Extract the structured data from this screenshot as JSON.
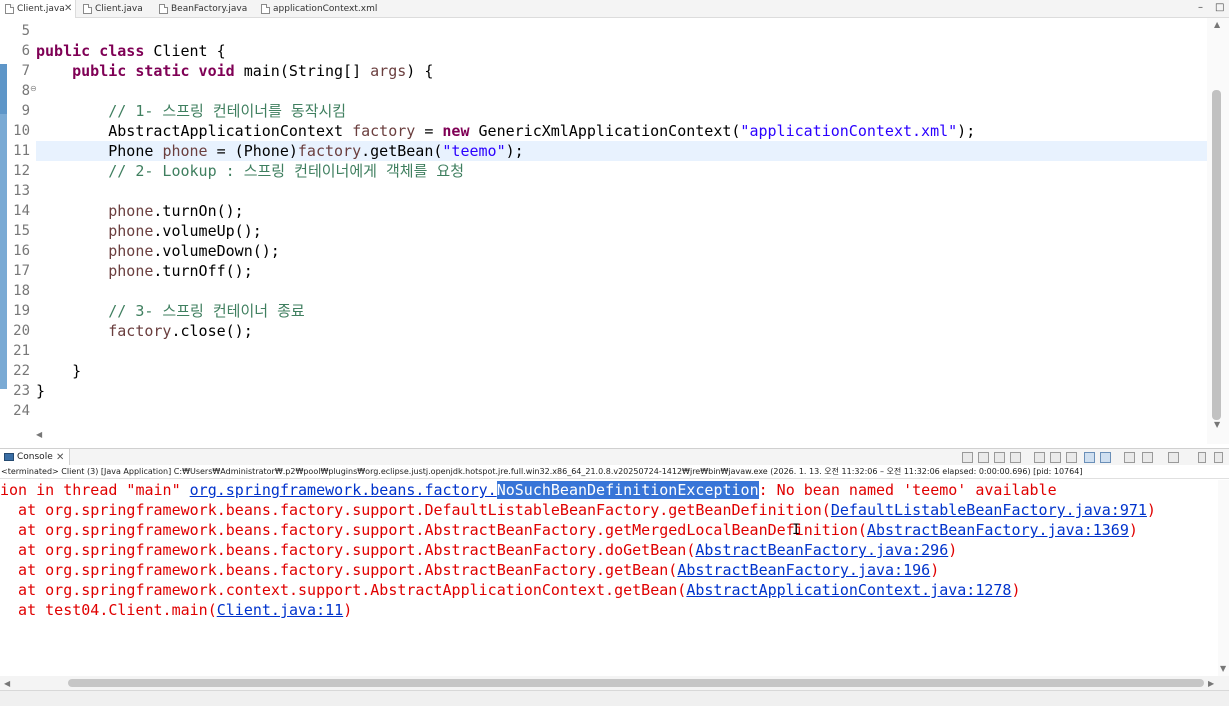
{
  "editor_tabs": [
    {
      "label": "Client.java",
      "active": true,
      "close": "✕"
    },
    {
      "label": "Client.java",
      "active": false
    },
    {
      "label": "BeanFactory.java",
      "active": false
    },
    {
      "label": "applicationContext.xml",
      "active": false
    }
  ],
  "window_controls": {
    "minimize": "–",
    "maximize": "□"
  },
  "code": {
    "lines": [
      {
        "n": "5",
        "current": false,
        "segs": []
      },
      {
        "n": "6",
        "current": false,
        "segs": [
          {
            "t": "public class",
            "c": "kw"
          },
          {
            "t": " Client {",
            "c": ""
          }
        ]
      },
      {
        "n": "7",
        "current": false,
        "fold": "⊖",
        "segs": [
          {
            "t": "    ",
            "c": ""
          },
          {
            "t": "public static void",
            "c": "kw"
          },
          {
            "t": " main(String[] ",
            "c": ""
          },
          {
            "t": "args",
            "c": "var"
          },
          {
            "t": ") {",
            "c": ""
          }
        ]
      },
      {
        "n": "8",
        "current": false,
        "segs": []
      },
      {
        "n": "9",
        "current": false,
        "segs": [
          {
            "t": "        ",
            "c": ""
          },
          {
            "t": "// 1- 스프링 컨테이너를 동작시킴",
            "c": "cmt"
          }
        ]
      },
      {
        "n": "10",
        "current": false,
        "segs": [
          {
            "t": "        AbstractApplicationContext ",
            "c": ""
          },
          {
            "t": "factory",
            "c": "var"
          },
          {
            "t": " = ",
            "c": ""
          },
          {
            "t": "new",
            "c": "kw"
          },
          {
            "t": " GenericXmlApplicationContext(",
            "c": ""
          },
          {
            "t": "\"applicationContext.xml\"",
            "c": "str"
          },
          {
            "t": ");",
            "c": ""
          }
        ]
      },
      {
        "n": "11",
        "current": true,
        "segs": [
          {
            "t": "        Phone ",
            "c": ""
          },
          {
            "t": "phone",
            "c": "var"
          },
          {
            "t": " = (Phone)",
            "c": ""
          },
          {
            "t": "factory",
            "c": "var"
          },
          {
            "t": ".getBean(",
            "c": ""
          },
          {
            "t": "\"teemo\"",
            "c": "str"
          },
          {
            "t": ");",
            "c": ""
          }
        ]
      },
      {
        "n": "12",
        "current": false,
        "segs": [
          {
            "t": "        ",
            "c": ""
          },
          {
            "t": "// 2- Lookup : 스프링 컨테이너에게 객체를 요청",
            "c": "cmt"
          }
        ]
      },
      {
        "n": "13",
        "current": false,
        "segs": []
      },
      {
        "n": "14",
        "current": false,
        "segs": [
          {
            "t": "        ",
            "c": ""
          },
          {
            "t": "phone",
            "c": "var"
          },
          {
            "t": ".turnOn();",
            "c": ""
          }
        ]
      },
      {
        "n": "15",
        "current": false,
        "segs": [
          {
            "t": "        ",
            "c": ""
          },
          {
            "t": "phone",
            "c": "var"
          },
          {
            "t": ".volumeUp();",
            "c": ""
          }
        ]
      },
      {
        "n": "16",
        "current": false,
        "segs": [
          {
            "t": "        ",
            "c": ""
          },
          {
            "t": "phone",
            "c": "var"
          },
          {
            "t": ".volumeDown();",
            "c": ""
          }
        ]
      },
      {
        "n": "17",
        "current": false,
        "segs": [
          {
            "t": "        ",
            "c": ""
          },
          {
            "t": "phone",
            "c": "var"
          },
          {
            "t": ".turnOff();",
            "c": ""
          }
        ]
      },
      {
        "n": "18",
        "current": false,
        "segs": []
      },
      {
        "n": "19",
        "current": false,
        "segs": [
          {
            "t": "        ",
            "c": ""
          },
          {
            "t": "// 3- 스프링 컨테이너 종료",
            "c": "cmt"
          }
        ]
      },
      {
        "n": "20",
        "current": false,
        "segs": [
          {
            "t": "        ",
            "c": ""
          },
          {
            "t": "factory",
            "c": "var"
          },
          {
            "t": ".close();",
            "c": ""
          }
        ]
      },
      {
        "n": "21",
        "current": false,
        "segs": []
      },
      {
        "n": "22",
        "current": false,
        "segs": [
          {
            "t": "    }",
            "c": ""
          }
        ]
      },
      {
        "n": "23",
        "current": false,
        "segs": [
          {
            "t": "}",
            "c": ""
          }
        ]
      },
      {
        "n": "24",
        "current": false,
        "segs": []
      }
    ]
  },
  "console": {
    "tab_label": "Console",
    "tab_close": "✕",
    "status": "<terminated> Client (3) [Java Application] C:₩Users₩Administrator₩.p2₩pool₩plugins₩org.eclipse.justj.openjdk.hotspot.jre.full.win32.x86_64_21.0.8.v20250724-1412₩jre₩bin₩javaw.exe  (2026. 1. 13. 오전 11:32:06 – 오전 11:32:06 elapsed: 0:00:00.696) [pid: 10764]",
    "output": [
      [
        {
          "t": "ion in thread \"main\" ",
          "c": ""
        },
        {
          "t": "org.springframework.beans.factory.",
          "c": "link"
        },
        {
          "t": "NoSuchBeanDefinitionException",
          "c": "link sel"
        },
        {
          "t": ": No bean named 'teemo' available",
          "c": ""
        }
      ],
      [
        {
          "t": "  at org.springframework.beans.factory.support.DefaultListableBeanFactory.getBeanDefinition(",
          "c": ""
        },
        {
          "t": "DefaultListableBeanFactory.java:971",
          "c": "link"
        },
        {
          "t": ")",
          "c": ""
        }
      ],
      [
        {
          "t": "  at org.springframework.beans.factory.support.AbstractBeanFactory.getMergedLocalBeanDefinition(",
          "c": ""
        },
        {
          "t": "AbstractBeanFactory.java:1369",
          "c": "link"
        },
        {
          "t": ")",
          "c": ""
        }
      ],
      [
        {
          "t": "  at org.springframework.beans.factory.support.AbstractBeanFactory.doGetBean(",
          "c": ""
        },
        {
          "t": "AbstractBeanFactory.java:296",
          "c": "link"
        },
        {
          "t": ")",
          "c": ""
        }
      ],
      [
        {
          "t": "  at org.springframework.beans.factory.support.AbstractBeanFactory.getBean(",
          "c": ""
        },
        {
          "t": "AbstractBeanFactory.java:196",
          "c": "link"
        },
        {
          "t": ")",
          "c": ""
        }
      ],
      [
        {
          "t": "  at org.springframework.context.support.AbstractApplicationContext.getBean(",
          "c": ""
        },
        {
          "t": "AbstractApplicationContext.java:1278",
          "c": "link"
        },
        {
          "t": ")",
          "c": ""
        }
      ],
      [
        {
          "t": "  at test04.Client.main(",
          "c": ""
        },
        {
          "t": "Client.java:11",
          "c": "link"
        },
        {
          "t": ")",
          "c": ""
        }
      ]
    ]
  },
  "colors": {
    "keyword": "#7f0055",
    "string": "#2a00ff",
    "comment": "#3f7f5f",
    "local_variable": "#6a3e3e",
    "error_text": "#e00000",
    "link": "#0033cc",
    "selection": "#3875d7",
    "current_line": "#e8f2fe"
  }
}
